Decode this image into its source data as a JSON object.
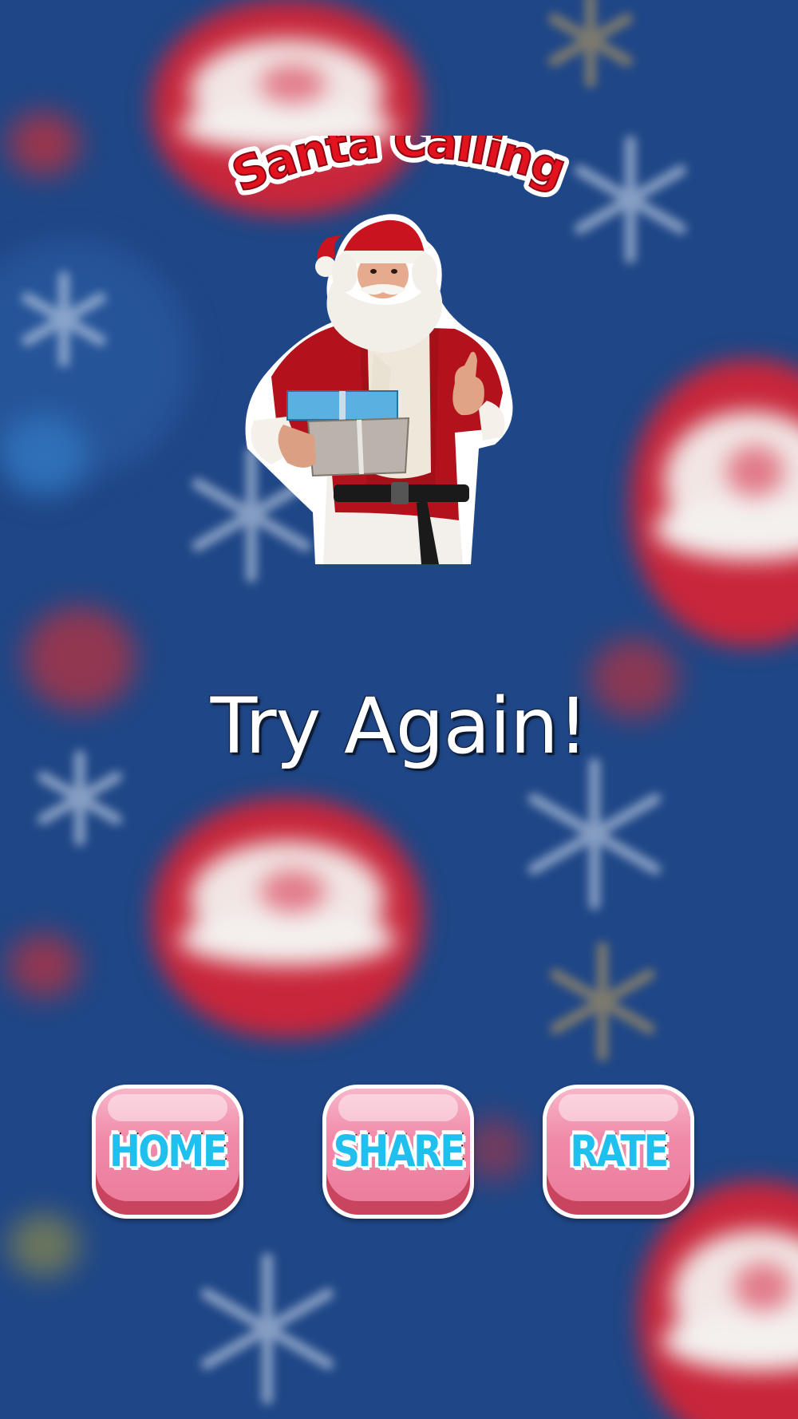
{
  "app": {
    "title": "Santa Calling"
  },
  "result": {
    "message": "Try Again!"
  },
  "buttons": {
    "home": "HOME",
    "share": "SHARE",
    "rate": "RATE"
  },
  "colors": {
    "background": "#1f4686",
    "title_red": "#e3121f",
    "button_pink": "#f08aa8",
    "button_text_cyan": "#1fc0ee"
  }
}
